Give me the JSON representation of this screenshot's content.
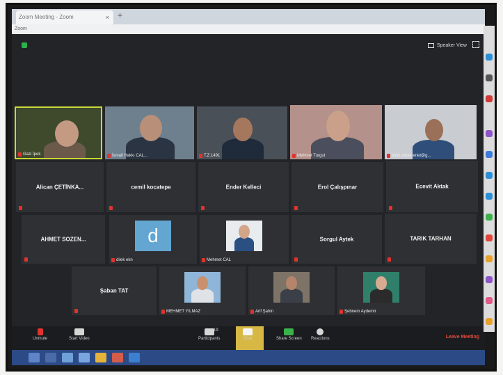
{
  "browser": {
    "tab_title": "Zoom Meeting - Zoom",
    "close_icon": "×",
    "new_tab_icon": "+",
    "menu_text": "Zoom"
  },
  "meeting": {
    "speaker_view_label": "Speaker View",
    "end_meeting_label": "Leave Meeting",
    "colors": {
      "active_speaker_border": "#c8d83a",
      "mute": "#e0332e",
      "end": "#e64b3b",
      "chat_highlight": "#d7b845"
    }
  },
  "video_tiles": [
    {
      "label": "Gazi İpek"
    },
    {
      "label": "İsmail Hakkı CAL..."
    },
    {
      "label": "T.Z.1491"
    },
    {
      "label": "Mehmet Turgut"
    },
    {
      "label": "aliuk.elbameriet@g..."
    }
  ],
  "name_tiles_row2": [
    {
      "name": "Alican ÇETİNKA..."
    },
    {
      "name": "cemil kocatepe"
    },
    {
      "name": "Ender Kelleci"
    },
    {
      "name": "Erol Çalışpınar"
    },
    {
      "name": "Ecevit Aktak"
    }
  ],
  "row3": [
    {
      "name": "AHMET SOZEN..."
    },
    {
      "letter": "d",
      "label": "dilek ekn"
    },
    {
      "label": "Mehmet CAL"
    },
    {
      "name": "Sorgul Aytek"
    },
    {
      "name": "TARIK TARHAN"
    }
  ],
  "row4": [
    {
      "name": "Şaban TAT"
    },
    {
      "label": "MEHMET YILMAZ"
    },
    {
      "label": "Arif Şahin"
    },
    {
      "label": "Şebnem Aydemir"
    }
  ],
  "toolbar": {
    "unmute": "Unmute",
    "start_video": "Start Video",
    "participants": "Participants",
    "participants_count": "19",
    "chat": "Chat",
    "share_screen": "Share Screen",
    "reactions": "Reactions"
  }
}
